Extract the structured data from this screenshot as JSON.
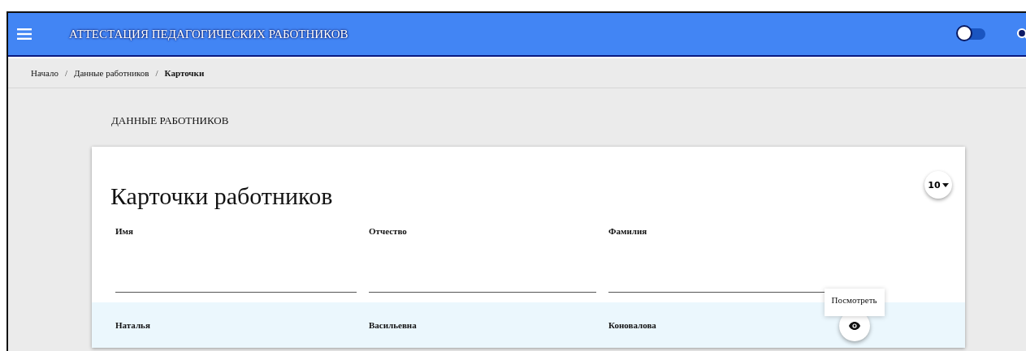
{
  "header": {
    "title": "АТТЕСТАЦИЯ ПЕДАГОГИЧЕСКИХ РАБОТНИКОВ",
    "toggle": {
      "on": false
    }
  },
  "breadcrumbs": [
    {
      "label": "Начало",
      "current": false
    },
    {
      "separator": "/",
      "label": "Данные работников",
      "current": false
    },
    {
      "separator": "/",
      "label": "Карточки",
      "current": true
    }
  ],
  "section_title": "ДАННЫЕ РАБОТНИКОВ",
  "card": {
    "title": "Карточки работников",
    "page_size": "10",
    "columns": [
      {
        "label": "Имя"
      },
      {
        "label": "Отчество"
      },
      {
        "label": "Фамилия"
      }
    ],
    "rows": [
      {
        "cells": [
          "Наталья",
          "Васильевна",
          "Коновалова"
        ],
        "tooltip": "Посмотреть"
      }
    ]
  }
}
